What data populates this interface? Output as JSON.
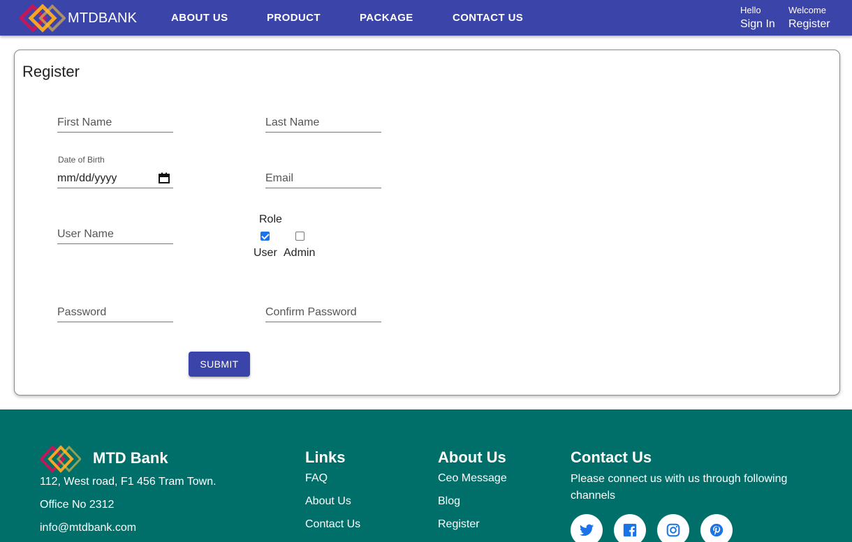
{
  "navbar": {
    "brand": "MTDBANK",
    "links": [
      "ABOUT US",
      "PRODUCT",
      "PACKAGE",
      "CONTACT US"
    ],
    "signin_greeting": "Hello",
    "signin_label": "Sign In",
    "register_greeting": "Welcome",
    "register_label": "Register"
  },
  "form": {
    "title": "Register",
    "first_name_placeholder": "First Name",
    "last_name_placeholder": "Last Name",
    "dob_label": "Date of Birth",
    "dob_value": "mm/dd/yyyy",
    "email_placeholder": "Email",
    "username_placeholder": "User Name",
    "role_label": "Role",
    "role_user_label": "User",
    "role_admin_label": "Admin",
    "role_user_checked": true,
    "role_admin_checked": false,
    "password_placeholder": "Password",
    "confirm_password_placeholder": "Confirm Password",
    "submit_label": "SUBMIT"
  },
  "footer": {
    "brand": "MTD Bank",
    "address": "112, West road, F1 456 Tram Town.",
    "office": "Office No 2312",
    "email": "info@mtdbank.com",
    "links_heading": "Links",
    "links": [
      "FAQ",
      "About Us",
      "Contact Us"
    ],
    "about_heading": "About Us",
    "about_links": [
      "Ceo Message",
      "Blog",
      "Register"
    ],
    "contact_heading": "Contact Us",
    "contact_text": "Please connect us with us through following channels",
    "social": [
      "twitter-icon",
      "facebook-icon",
      "instagram-icon",
      "pinterest-icon"
    ]
  },
  "colors": {
    "primary": "#3b44a8",
    "footer_bg": "#006f6a",
    "social_icon": "#1a73e8"
  }
}
